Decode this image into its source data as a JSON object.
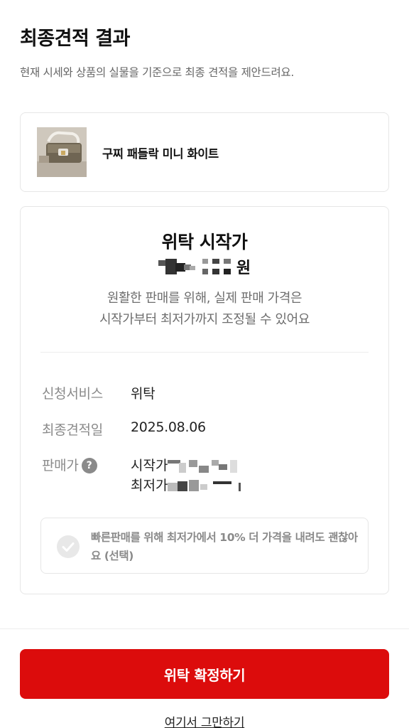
{
  "header": {
    "title": "최종견적 결과",
    "subtitle": "현재 시세와 상품의 실물을 기준으로 최종 견적을 제안드려요."
  },
  "product": {
    "name": "구찌 패들락 미니 화이트"
  },
  "estimate": {
    "heading": "위탁 시작가",
    "price_unit": "원",
    "notice_line1": "원활한 판매를 위해, 실제 판매 가격은",
    "notice_line2": "시작가부터 최저가까지 조정될 수 있어요"
  },
  "details": {
    "service_label": "신청서비스",
    "service_value": "위탁",
    "date_label": "최종견적일",
    "date_value": "2025.08.06",
    "price_label": "판매가",
    "help_icon": "question-icon",
    "start_price_label": "시작가",
    "min_price_label": "최저가"
  },
  "option": {
    "text": "빠른판매를 위해 최저가에서 10% 더 가격을 내려도 괜찮아요 (선택)",
    "checked": false
  },
  "actions": {
    "confirm_label": "위탁 확정하기",
    "quit_label": "여기서 그만하기"
  },
  "colors": {
    "accent": "#dc0c0c",
    "muted_text": "#8a8a8a"
  }
}
